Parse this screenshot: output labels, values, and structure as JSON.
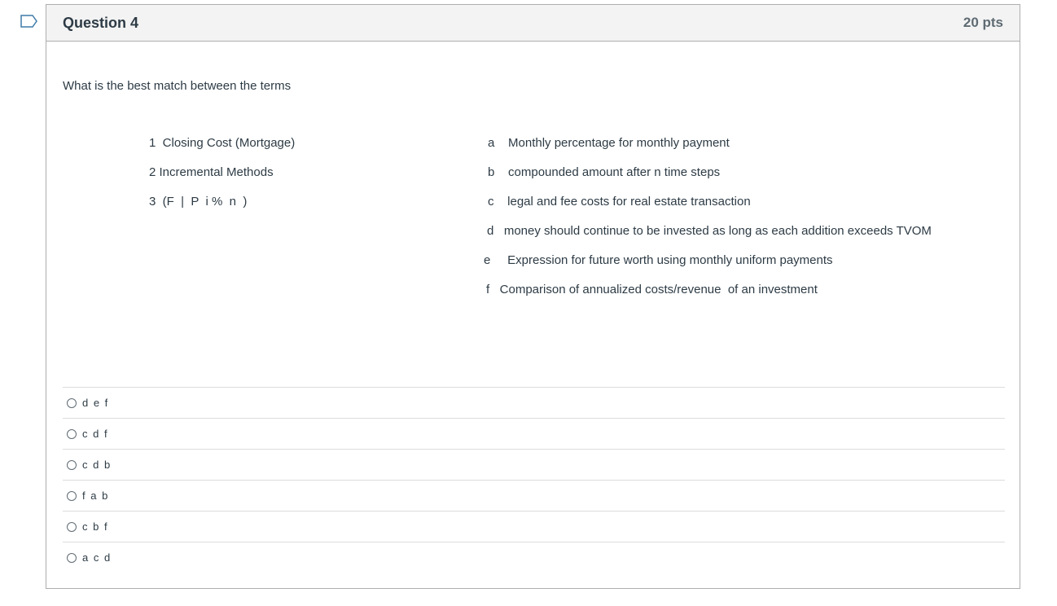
{
  "question": {
    "title": "Question 4",
    "points": "20 pts",
    "prompt": "What is the best match between the terms",
    "terms": [
      "1  Closing Cost (Mortgage)",
      "2 Incremental Methods",
      "3  (F  |  P  i %  n  )"
    ],
    "definitions": [
      "a    Monthly percentage for monthly payment",
      "b    compounded amount after n time steps",
      "c    legal and fee costs for real estate transaction",
      "d   money should continue to be invested as long as each addition exceeds TVOM",
      "e     Expression for future worth using monthly uniform payments",
      "f   Comparison of annualized costs/revenue  of an investment"
    ],
    "answers": [
      {
        "label": "d e f",
        "selected": false
      },
      {
        "label": "c d f",
        "selected": false
      },
      {
        "label": "c d b",
        "selected": false
      },
      {
        "label": "f a b",
        "selected": false
      },
      {
        "label": "c b f",
        "selected": false
      },
      {
        "label": "a c d",
        "selected": false
      }
    ]
  },
  "icons": {
    "flag": "flag-question-icon"
  },
  "colors": {
    "flag_stroke": "#3f7ca8",
    "header_bg": "#f3f3f3",
    "border": "#aeaeae",
    "text": "#2d3b45"
  }
}
